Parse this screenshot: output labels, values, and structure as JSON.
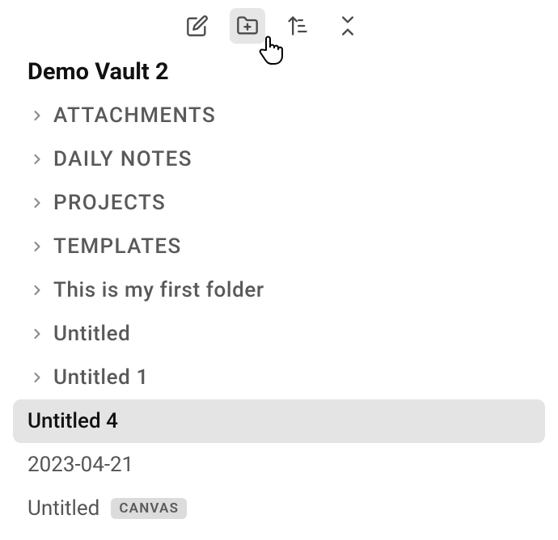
{
  "vault_title": "Demo Vault 2",
  "toolbar": {
    "new_note": "New note",
    "new_folder": "New folder",
    "sort": "Change sort order",
    "collapse": "Collapse all"
  },
  "items": [
    {
      "label": "ATTACHMENTS",
      "type": "folder",
      "upper": true
    },
    {
      "label": "DAILY NOTES",
      "type": "folder",
      "upper": true
    },
    {
      "label": "PROJECTS",
      "type": "folder",
      "upper": true
    },
    {
      "label": "TEMPLATES",
      "type": "folder",
      "upper": true
    },
    {
      "label": "This is my first folder",
      "type": "folder",
      "upper": false
    },
    {
      "label": "Untitled",
      "type": "folder",
      "upper": false
    },
    {
      "label": "Untitled 1",
      "type": "folder",
      "upper": false
    },
    {
      "label": "Untitled 4",
      "type": "file",
      "selected": true
    },
    {
      "label": "2023-04-21",
      "type": "file"
    },
    {
      "label": "Untitled",
      "type": "file",
      "badge": "CANVAS"
    }
  ]
}
